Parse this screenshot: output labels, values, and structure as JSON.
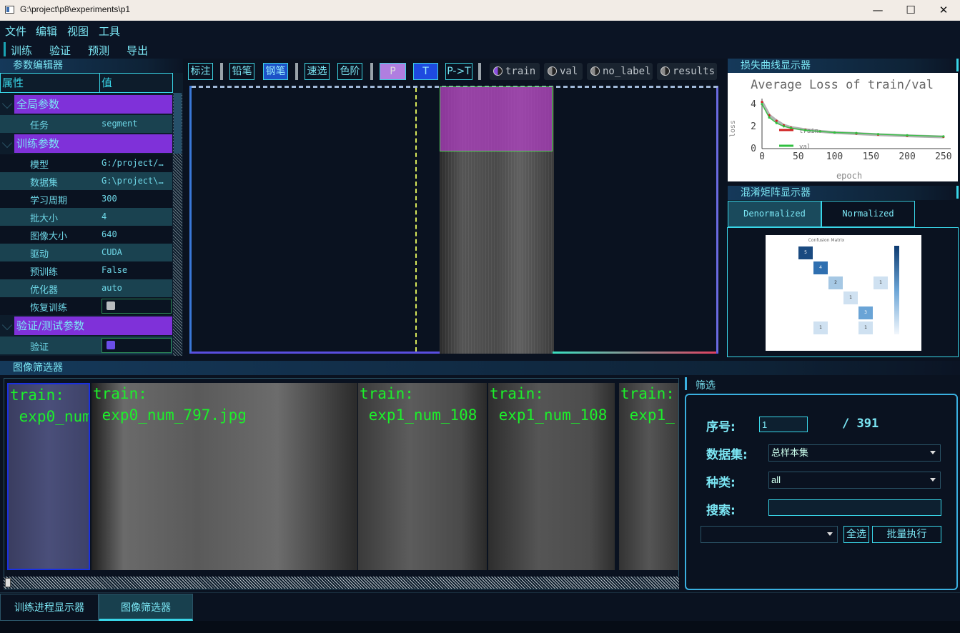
{
  "window": {
    "title": "G:\\project\\p8\\experiments\\p1",
    "min": "—",
    "max": "☐",
    "close": "✕"
  },
  "menu": [
    "文件",
    "编辑",
    "视图",
    "工具"
  ],
  "modes": [
    "训练",
    "验证",
    "预测",
    "导出"
  ],
  "params": {
    "title": "参数编辑器",
    "col_attr": "属性",
    "col_val": "值",
    "groups": [
      "全局参数",
      "训练参数",
      "验证/测试参数"
    ],
    "rows": [
      {
        "k": "任务",
        "v": "segment"
      },
      {
        "k": "模型",
        "v": "G:/project/…"
      },
      {
        "k": "数据集",
        "v": "G:\\project\\…"
      },
      {
        "k": "学习周期",
        "v": "300"
      },
      {
        "k": "批大小",
        "v": "4"
      },
      {
        "k": "图像大小",
        "v": "640"
      },
      {
        "k": "驱动",
        "v": "CUDA"
      },
      {
        "k": "预训练",
        "v": "False"
      },
      {
        "k": "优化器",
        "v": "auto"
      },
      {
        "k": "恢复训练",
        "v": ""
      },
      {
        "k": "验证",
        "v": ""
      }
    ]
  },
  "toolbar": {
    "tools": [
      "标注",
      "铅笔",
      "钢笔",
      "速选",
      "色阶"
    ],
    "p_label": "P",
    "t_label": "T",
    "pt_label": "P->T",
    "datasets": [
      "train",
      "val",
      "no_label",
      "results"
    ]
  },
  "loss": {
    "title": "损失曲线显示器",
    "chart_data": {
      "type": "line",
      "title": "Average Loss of train/val",
      "xlabel": "epoch",
      "ylabel": "loss",
      "xlim": [
        0,
        260
      ],
      "ylim": [
        0,
        4.5
      ],
      "xticks": [
        0,
        50,
        100,
        150,
        200,
        250
      ],
      "yticks": [
        0,
        2,
        4
      ],
      "series": [
        {
          "name": "train",
          "color": "#d02020",
          "x": [
            0,
            10,
            20,
            30,
            40,
            60,
            80,
            100,
            130,
            160,
            200,
            250
          ],
          "y": [
            4.2,
            3.0,
            2.5,
            2.1,
            1.9,
            1.7,
            1.55,
            1.45,
            1.35,
            1.25,
            1.15,
            1.05
          ]
        },
        {
          "name": "val",
          "color": "#30c040",
          "x": [
            0,
            10,
            20,
            30,
            40,
            60,
            80,
            100,
            130,
            160,
            200,
            250
          ],
          "y": [
            4.0,
            2.8,
            2.3,
            2.0,
            1.85,
            1.65,
            1.55,
            1.45,
            1.4,
            1.3,
            1.2,
            1.1
          ]
        }
      ]
    }
  },
  "confusion": {
    "title": "混淆矩阵显示器",
    "tabs": [
      "Denormalized",
      "Normalized"
    ],
    "heading": "Confusion Matrix",
    "cells": [
      {
        "r": 0,
        "c": 0,
        "v": "5",
        "color": "#1a4a80"
      },
      {
        "r": 1,
        "c": 1,
        "v": "4",
        "color": "#2f6fb0"
      },
      {
        "r": 2,
        "c": 2,
        "v": "2",
        "color": "#a6c8e4"
      },
      {
        "r": 2,
        "c": 5,
        "v": "1",
        "color": "#cfe1f1"
      },
      {
        "r": 3,
        "c": 3,
        "v": "1",
        "color": "#cfe1f1"
      },
      {
        "r": 4,
        "c": 4,
        "v": "3",
        "color": "#6aa4d6"
      },
      {
        "r": 5,
        "c": 1,
        "v": "1",
        "color": "#cfe1f1"
      },
      {
        "r": 5,
        "c": 4,
        "v": "1",
        "color": "#cfe1f1"
      }
    ]
  },
  "filter": {
    "title": "图像筛选器",
    "panel_title": "筛选",
    "index_label": "序号:",
    "index_value": "1",
    "total": "/  391",
    "dataset_label": "数据集:",
    "dataset_value": "总样本集",
    "type_label": "种类:",
    "type_value": "all",
    "search_label": "搜索:",
    "search_value": "",
    "action_value": "",
    "select_all": "全选",
    "batch_run": "批量执行",
    "thumbs": [
      {
        "label": "train:\n exp0_num"
      },
      {
        "label": "train:\n exp0_num_797.jpg"
      },
      {
        "label": "train:\n exp1_num_108"
      },
      {
        "label": "train:\n exp1_num_108"
      },
      {
        "label": "train:\n exp1_"
      }
    ]
  },
  "bottom_tabs": [
    "训练进程显示器",
    "图像筛选器"
  ]
}
